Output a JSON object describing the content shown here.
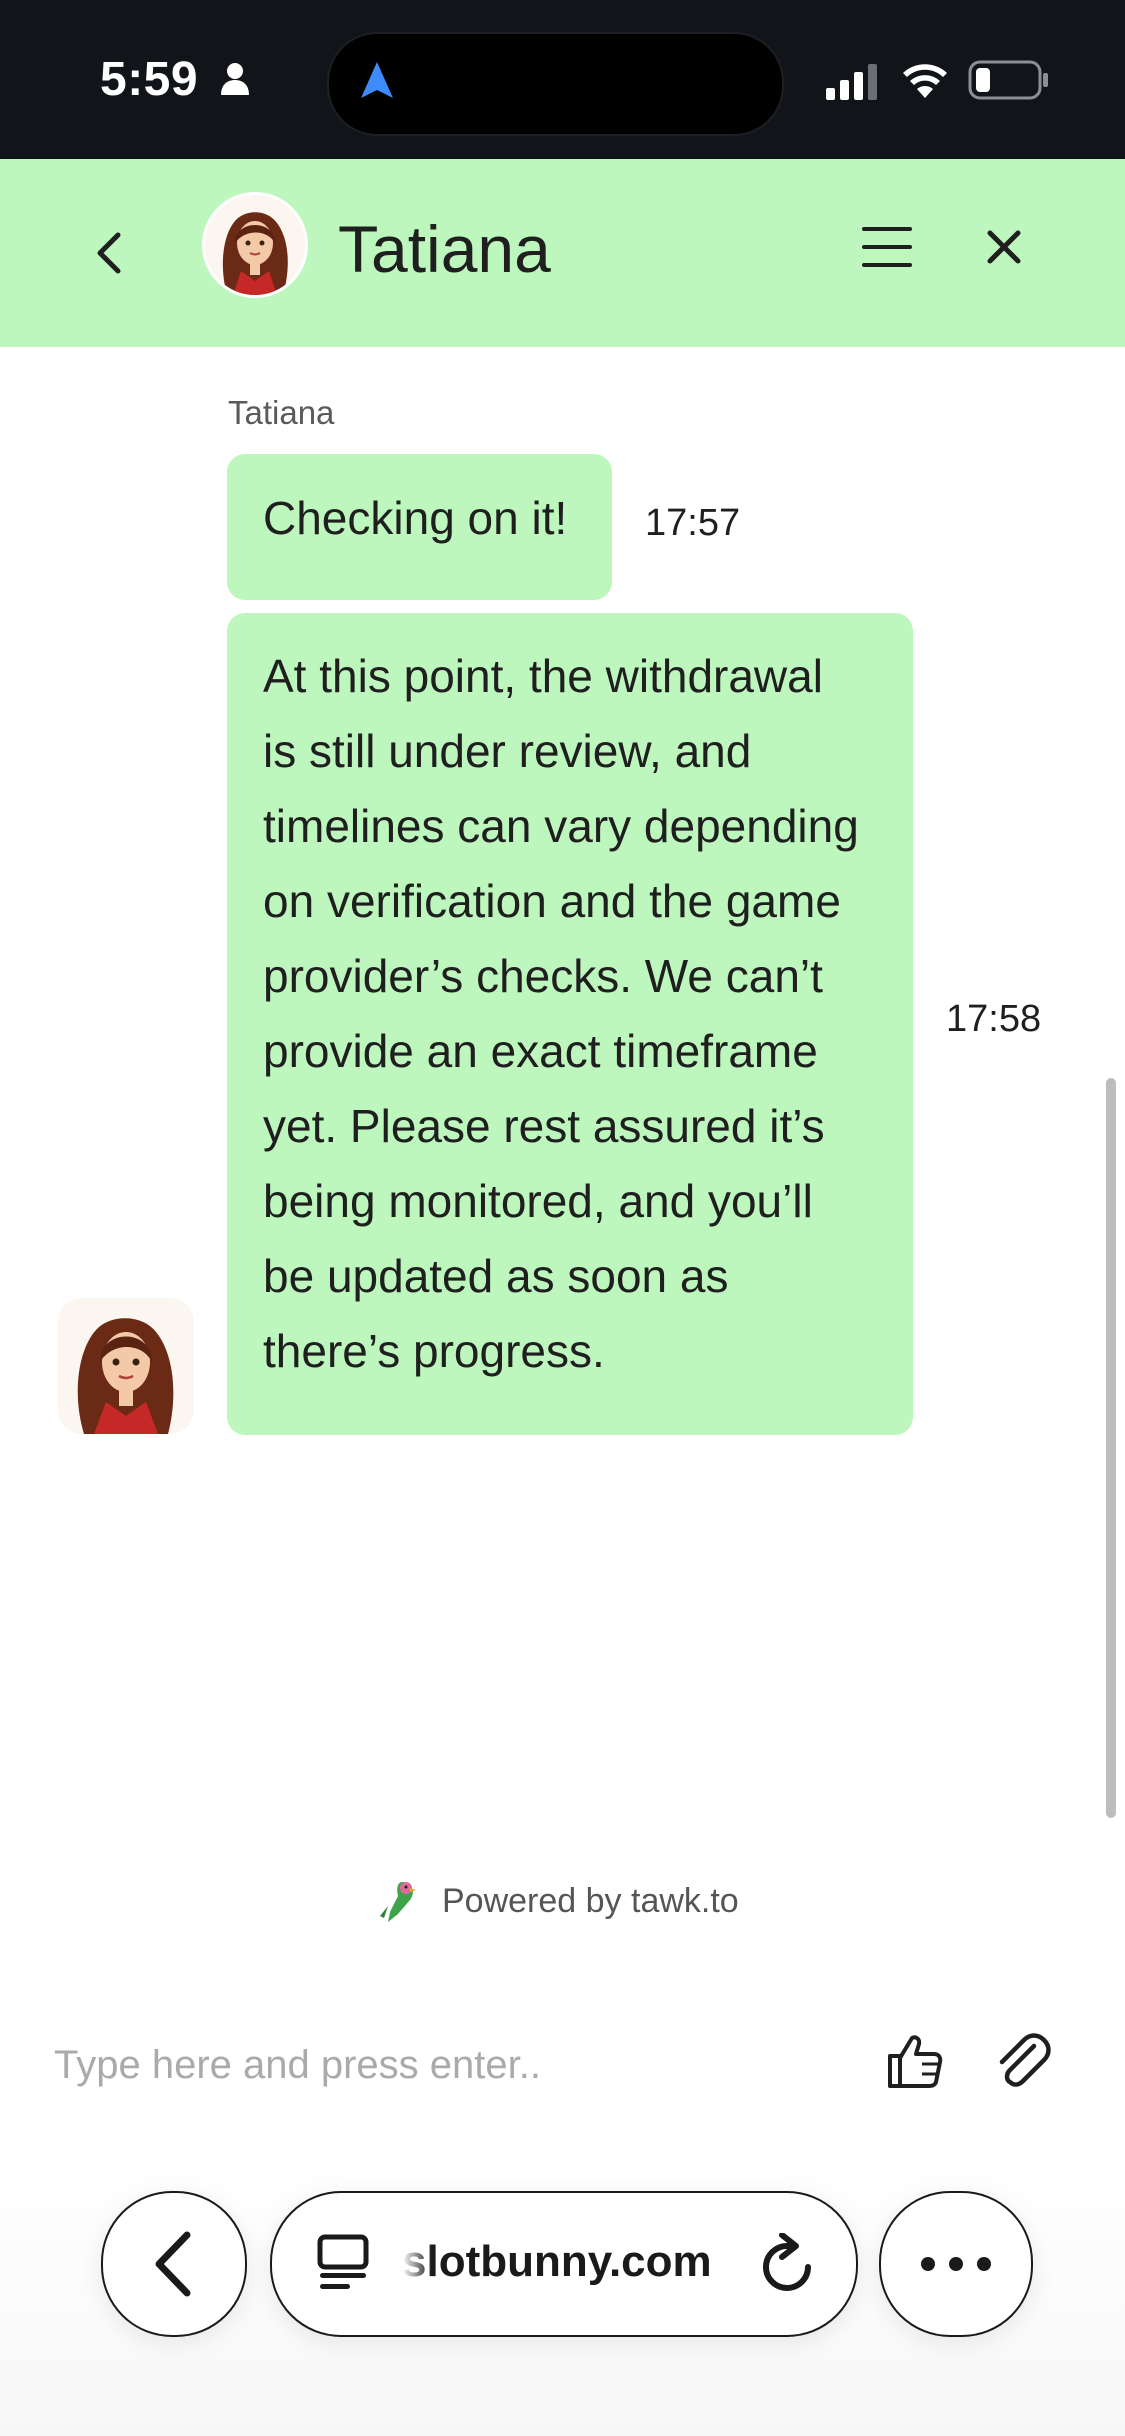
{
  "status_bar": {
    "time": "5:59",
    "icons": [
      "person-icon",
      "navigation-arrow-icon",
      "cellular-signal-icon",
      "wifi-icon",
      "battery-icon"
    ]
  },
  "chat_header": {
    "agent_name": "Tatiana",
    "icons": [
      "back-chevron-icon",
      "avatar",
      "menu-icon",
      "close-icon"
    ],
    "background_color": "#bdf7bd"
  },
  "messages": [
    {
      "sender": "Tatiana",
      "text": "Checking on it!",
      "time": "17:57"
    },
    {
      "lines": [
        "At this point, the withdrawal",
        "is still under review, and",
        "timelines can vary depending",
        "on verification and the game",
        "provider’s checks. We can’t",
        "provide an exact timeframe",
        "yet. Please rest assured it’s",
        "being monitored, and you’ll",
        "be updated as soon as",
        "there’s progress."
      ],
      "time": "17:58"
    }
  ],
  "branding": {
    "powered_by": "Powered by tawk.to",
    "icon": "parrot-icon"
  },
  "composer": {
    "placeholder": "Type here and press enter..",
    "value": "",
    "icons": [
      "thumbs-up-icon",
      "paperclip-icon"
    ]
  },
  "browser": {
    "url": "slotbunny.com",
    "icons": [
      "back-icon",
      "tabs-icon",
      "reload-icon",
      "more-icon"
    ]
  },
  "colors": {
    "bubble": "#bdf7bd",
    "status_bar": "#111418",
    "accent_arrow": "#3d8bfd"
  }
}
